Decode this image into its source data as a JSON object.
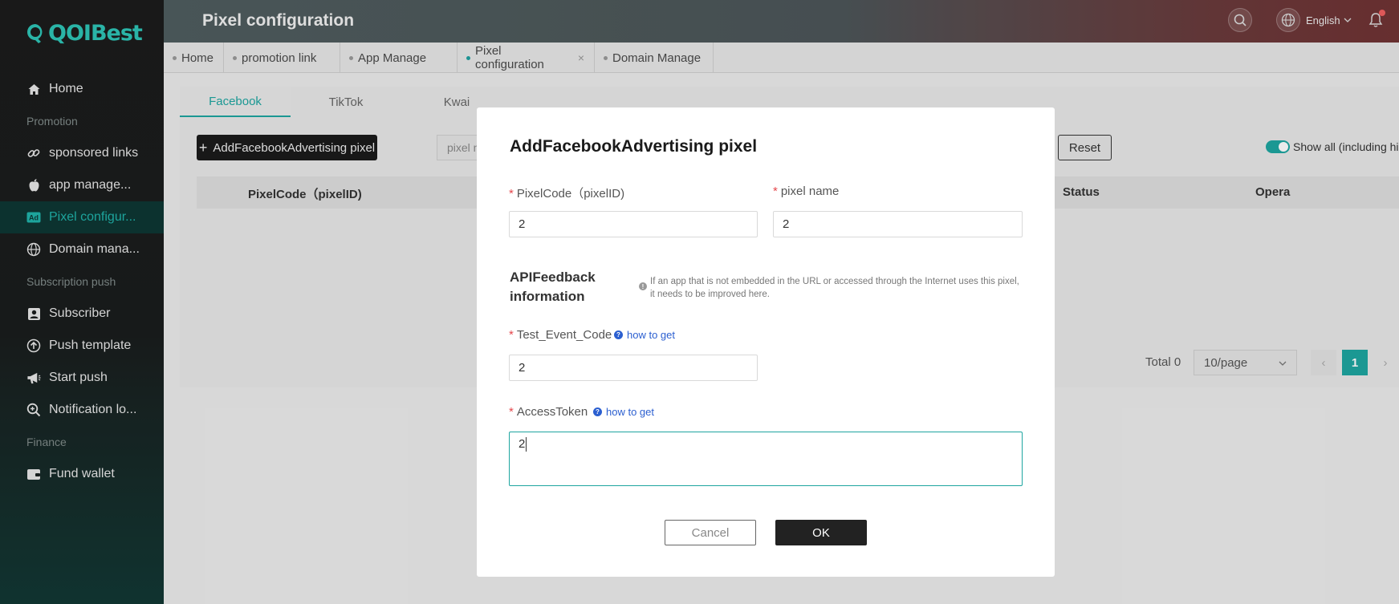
{
  "app": {
    "logo_text": "QOIBest",
    "accent_color": "#1ea5a0"
  },
  "sidebar": {
    "items": [
      {
        "type": "item",
        "label": "Home",
        "icon": "home-icon"
      },
      {
        "type": "group",
        "label": "Promotion"
      },
      {
        "type": "item",
        "label": "sponsored links",
        "icon": "link-icon"
      },
      {
        "type": "item",
        "label": "app manage...",
        "icon": "apple-icon"
      },
      {
        "type": "item",
        "label": "Pixel configur...",
        "icon": "ad-icon",
        "active": true
      },
      {
        "type": "item",
        "label": "Domain mana...",
        "icon": "globe-icon"
      },
      {
        "type": "group",
        "label": "Subscription push"
      },
      {
        "type": "item",
        "label": "Subscriber",
        "icon": "subscriber-icon"
      },
      {
        "type": "item",
        "label": "Push template",
        "icon": "upload-icon"
      },
      {
        "type": "item",
        "label": "Start push",
        "icon": "megaphone-icon"
      },
      {
        "type": "item",
        "label": "Notification lo...",
        "icon": "search-doc-icon"
      },
      {
        "type": "group",
        "label": "Finance"
      },
      {
        "type": "item",
        "label": "Fund wallet",
        "icon": "wallet-icon"
      }
    ]
  },
  "header": {
    "title": "Pixel configuration",
    "language": "English"
  },
  "page_tabs": [
    {
      "label": "Home"
    },
    {
      "label": "promotion link"
    },
    {
      "label": "App Manage"
    },
    {
      "label": "Pixel configuration",
      "active": true,
      "closable": true
    },
    {
      "label": "Domain Manage"
    }
  ],
  "platform_tabs": [
    {
      "label": "Facebook",
      "active": true
    },
    {
      "label": "TikTok"
    },
    {
      "label": "Kwai"
    }
  ],
  "toolbar": {
    "add_button": "AddFacebookAdvertising pixel",
    "filter_placeholder": "pixel n",
    "reset_button": "Reset",
    "show_all_label": "Show all (including hid",
    "show_all_on": true
  },
  "table": {
    "columns": [
      "PixelCode（pixelID)",
      "Status",
      "Opera"
    ]
  },
  "pagination": {
    "total_text": "Total 0",
    "page_size": "10/page",
    "current_page": "1"
  },
  "modal": {
    "title": "AddFacebookAdvertising pixel",
    "pixel_code_label": "PixelCode（pixelID)",
    "pixel_code_value": "2",
    "pixel_name_label": "pixel name",
    "pixel_name_value": "2",
    "section_title": "APIFeedback information",
    "section_info": "If an app that is not embedded in the URL or accessed through the Internet uses this pixel, it needs to be improved here.",
    "test_event_label": "Test_Event_Code",
    "test_event_help": "how to get",
    "test_event_value": "2",
    "access_token_label": "AccessToken",
    "access_token_help": "how to get",
    "access_token_value": "2",
    "cancel_button": "Cancel",
    "ok_button": "OK"
  }
}
